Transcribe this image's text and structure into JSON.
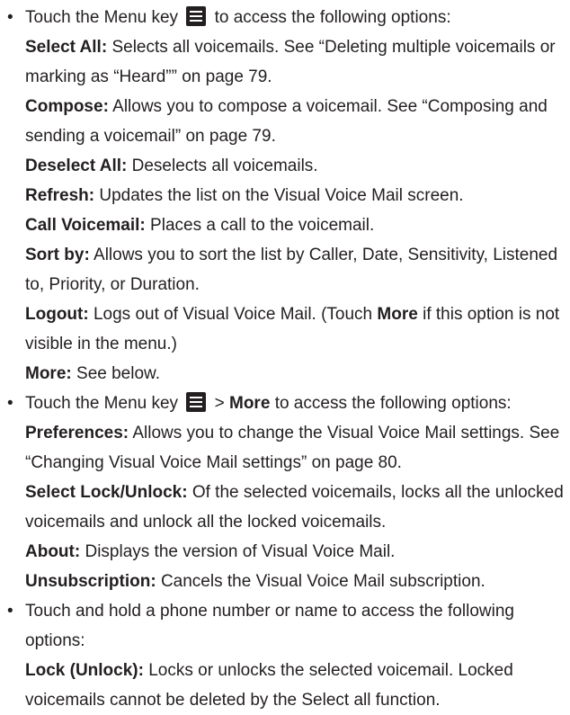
{
  "bullet_char": "•",
  "section1": {
    "lead_before": "Touch the Menu key",
    "lead_after": "to access the following options:",
    "items": [
      {
        "term": "Select All:",
        "desc": "Selects all voicemails. See “Deleting multiple voicemails or marking as “Heard”” on page 79."
      },
      {
        "term": "Compose:",
        "desc": "Allows you to compose a voicemail. See “Composing and sending a voicemail” on page 79."
      },
      {
        "term": "Deselect All:",
        "desc": "Deselects all voicemails."
      },
      {
        "term": "Refresh:",
        "desc": "Updates the list on the Visual Voice Mail screen."
      },
      {
        "term": "Call Voicemail:",
        "desc": "Places a call to the voicemail."
      },
      {
        "term": "Sort by:",
        "desc": "Allows you to sort the list by Caller, Date, Sensitivity, Listened to, Priority, or Duration."
      },
      {
        "term": "Logout:",
        "desc": "Logs out of Visual Voice Mail. (Touch"
      },
      {
        "term": "More:",
        "desc": "See below."
      }
    ],
    "logout_more": "More",
    "logout_tail": "if this option is not visible in the menu.)"
  },
  "section2": {
    "lead_before": "Touch the Menu key",
    "lead_sep": ">",
    "lead_more": "More",
    "lead_after": "to access the following options:",
    "items": [
      {
        "term": "Preferences:",
        "desc": "Allows you to change the Visual Voice Mail settings. See “Changing Visual Voice Mail settings” on page 80."
      },
      {
        "term": "Select Lock/Unlock:",
        "desc": "Of the selected voicemails, locks all the unlocked voicemails and unlock all the locked voicemails."
      },
      {
        "term": "About:",
        "desc": "Displays the version of Visual Voice Mail."
      },
      {
        "term": "Unsubscription:",
        "desc": "Cancels the Visual Voice Mail subscription."
      }
    ]
  },
  "section3": {
    "lead": "Touch and hold a phone number or name to access the following options:",
    "items": [
      {
        "term": "Lock (Unlock):",
        "desc": "Locks or unlocks the selected voicemail. Locked voicemails cannot be deleted by the Select all function."
      }
    ]
  }
}
